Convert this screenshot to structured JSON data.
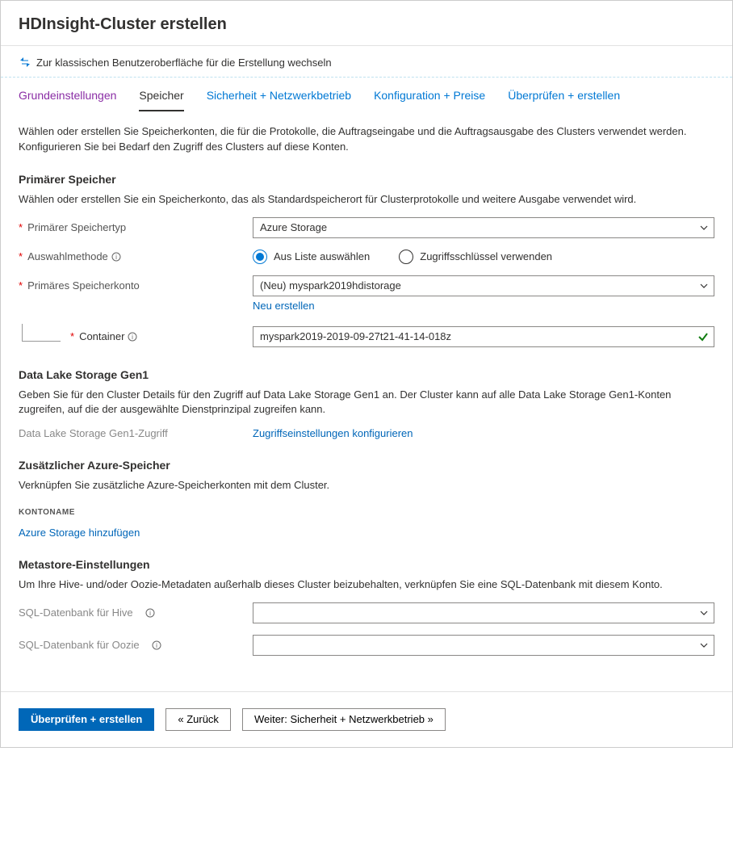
{
  "header": {
    "title": "HDInsight-Cluster erstellen"
  },
  "classic_link": "Zur klassischen Benutzeroberfläche für die Erstellung wechseln",
  "tabs": {
    "basics": "Grundeinstellungen",
    "storage": "Speicher",
    "security": "Sicherheit + Netzwerkbetrieb",
    "config": "Konfiguration + Preise",
    "review": "Überprüfen + erstellen"
  },
  "intro": "Wählen oder erstellen Sie Speicherkonten, die für die Protokolle, die Auftragseingabe und die Auftragsausgabe des Clusters verwendet werden. Konfigurieren Sie bei Bedarf den Zugriff des Clusters auf diese Konten.",
  "primary": {
    "title": "Primärer Speicher",
    "desc": "Wählen oder erstellen Sie ein Speicherkonto, das als Standardspeicherort für Clusterprotokolle und weitere Ausgabe verwendet wird.",
    "type_label": "Primärer Speichertyp",
    "type_value": "Azure Storage",
    "method_label": "Auswahlmethode",
    "method_opt1": "Aus Liste auswählen",
    "method_opt2": "Zugriffsschlüssel verwenden",
    "account_label": "Primäres Speicherkonto",
    "account_value": "(Neu) myspark2019hdistorage",
    "create_new": "Neu erstellen",
    "container_label": "Container",
    "container_value": "myspark2019-2019-09-27t21-41-14-018z"
  },
  "gen1": {
    "title": "Data Lake Storage Gen1",
    "desc": "Geben Sie für den Cluster Details für den Zugriff auf Data Lake Storage Gen1 an. Der Cluster kann auf alle Data Lake Storage Gen1-Konten zugreifen, auf die der ausgewählte Dienstprinzipal zugreifen kann.",
    "access_label": "Data Lake Storage Gen1-Zugriff",
    "access_link": "Zugriffseinstellungen konfigurieren"
  },
  "additional": {
    "title": "Zusätzlicher Azure-Speicher",
    "desc": "Verknüpfen Sie zusätzliche Azure-Speicherkonten mit dem Cluster.",
    "account_header": "KONTONAME",
    "add_link": "Azure Storage hinzufügen"
  },
  "metastore": {
    "title": "Metastore-Einstellungen",
    "desc": "Um Ihre Hive- und/oder Oozie-Metadaten außerhalb dieses Cluster beizubehalten, verknüpfen Sie eine SQL-Datenbank mit diesem Konto.",
    "hive_label": "SQL-Datenbank für Hive",
    "oozie_label": "SQL-Datenbank für Oozie"
  },
  "footer": {
    "review": "Überprüfen + erstellen",
    "back": "«  Zurück",
    "next": "Weiter: Sicherheit + Netzwerkbetrieb  »"
  }
}
